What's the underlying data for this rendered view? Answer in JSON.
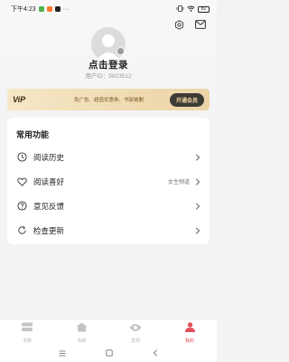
{
  "status_bar": {
    "time": "下午4:23",
    "battery": "81"
  },
  "profile": {
    "login_label": "点击登录",
    "user_id": "用户ID：5823512"
  },
  "vip_banner": {
    "logo": "ViP",
    "description": "免广告、超值优惠券、书架被删",
    "button_label": "开通会员"
  },
  "functions": {
    "title": "常用功能",
    "items": [
      {
        "label": "阅读历史",
        "extra": "",
        "icon": "clock-icon"
      },
      {
        "label": "阅读喜好",
        "extra": "女生频道",
        "icon": "heart-icon"
      },
      {
        "label": "意见反馈",
        "extra": "",
        "icon": "question-icon"
      },
      {
        "label": "检查更新",
        "extra": "",
        "icon": "refresh-icon"
      }
    ]
  },
  "bottom_nav": {
    "items": [
      {
        "label": "书架",
        "icon": "bookshelf-icon",
        "active": false
      },
      {
        "label": "书城",
        "icon": "bookstore-icon",
        "active": false
      },
      {
        "label": "发现",
        "icon": "discover-icon",
        "active": false
      },
      {
        "label": "我的",
        "icon": "profile-icon",
        "active": true
      }
    ],
    "active_color": "#e0505a",
    "inactive_color": "#b5b5b5"
  },
  "colors": {
    "vip_gold": "#f1dfb8",
    "vip_button": "#3d3a36",
    "accent_red": "#e0505a"
  }
}
